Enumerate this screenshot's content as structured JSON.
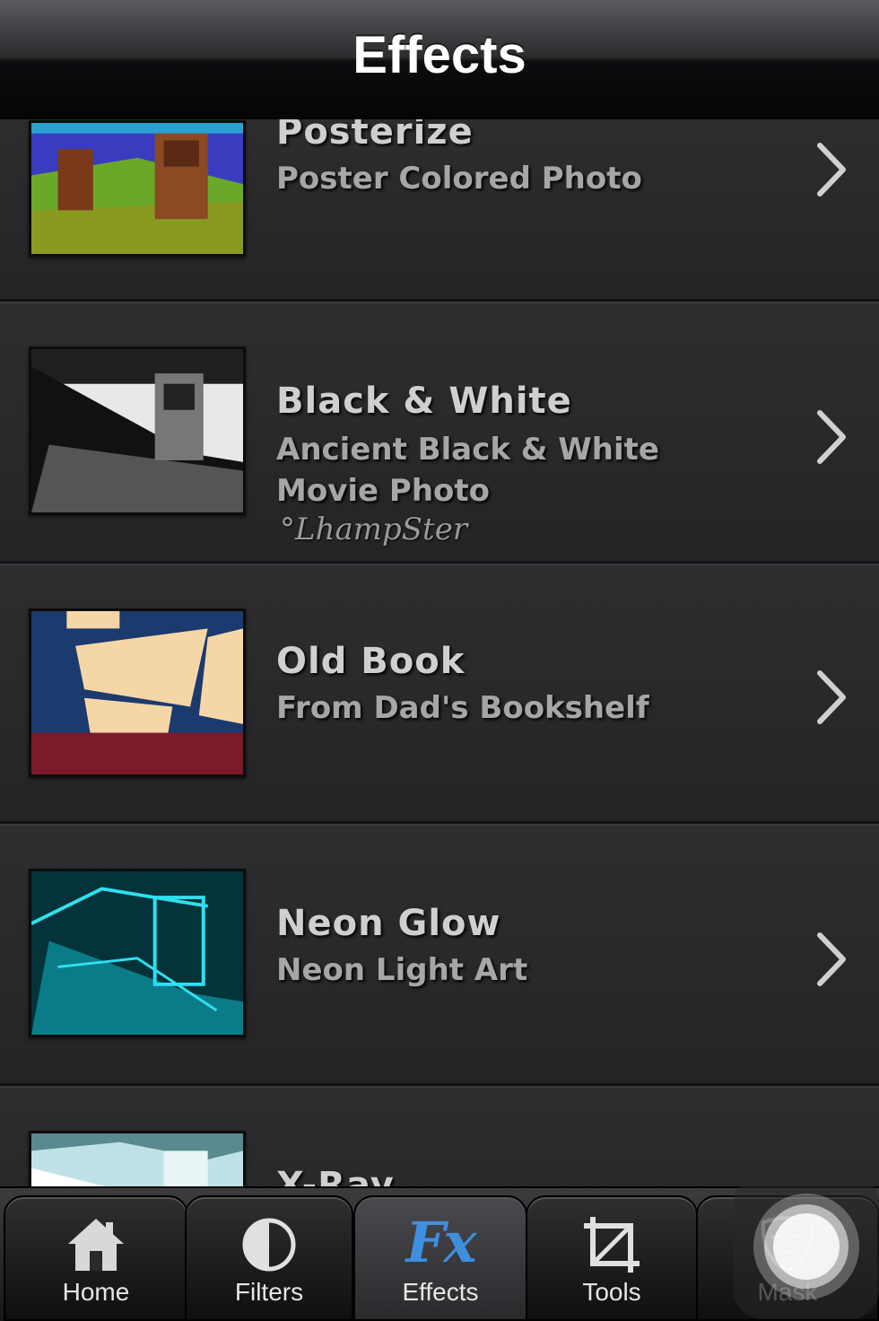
{
  "header": {
    "title": "Effects"
  },
  "effects": [
    {
      "title": "Posterize",
      "subtitle": "Poster Colored Photo"
    },
    {
      "title": "Black & White",
      "subtitle_line1": "Ancient Black & White",
      "subtitle_line2": "Movie Photo",
      "credit": "°LhampSter"
    },
    {
      "title": "Old Book",
      "subtitle": "From Dad's Bookshelf"
    },
    {
      "title": "Neon Glow",
      "subtitle": "Neon Light Art"
    },
    {
      "title": "X-Ray"
    }
  ],
  "tabbar": {
    "tabs": [
      {
        "label": "Home",
        "icon": "house-icon"
      },
      {
        "label": "Filters",
        "icon": "half-circle-icon"
      },
      {
        "label": "Effects",
        "icon": "fx-icon",
        "glyph": "Fx",
        "active": true
      },
      {
        "label": "Tools",
        "icon": "crop-icon"
      },
      {
        "label": "Mask",
        "icon": "theater-mask-icon"
      }
    ]
  },
  "colors": {
    "accent": "#3f8fe0",
    "background": "#2a2a2c"
  }
}
